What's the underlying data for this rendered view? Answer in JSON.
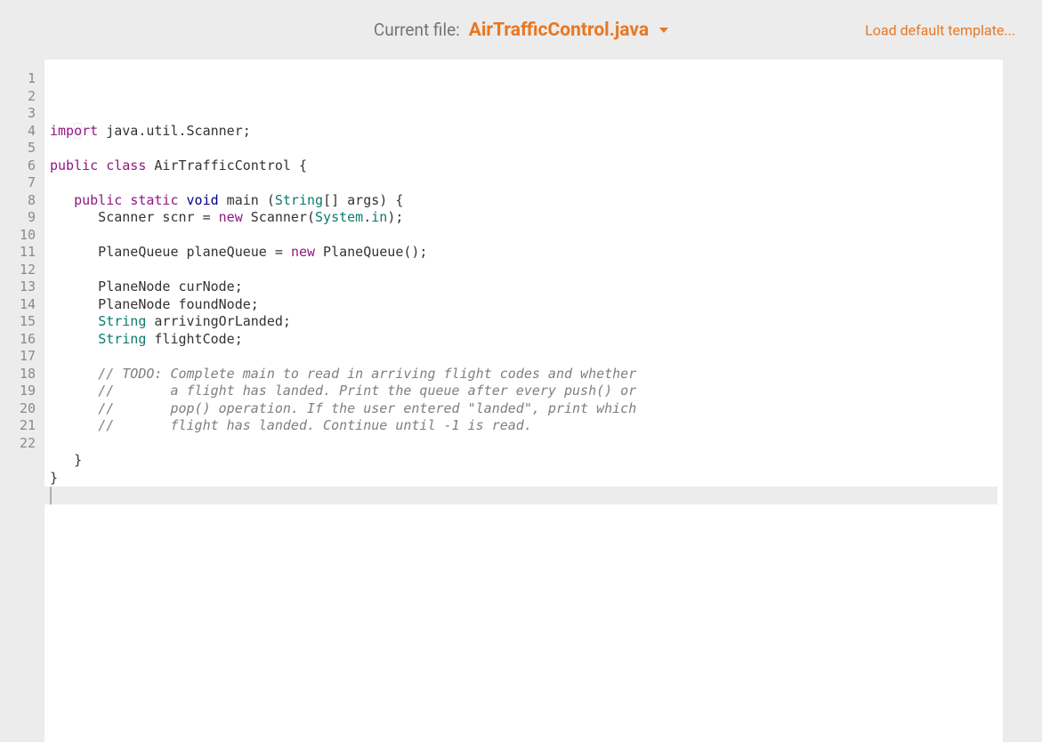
{
  "header": {
    "current_file_label": "Current file:",
    "file_name": "AirTrafficControl.java",
    "load_default": "Load default template..."
  },
  "editor": {
    "line_count": 22,
    "cursor_line": 22,
    "code_tokens": [
      [
        [
          "import",
          "kw-purple"
        ],
        [
          " java.util.Scanner;",
          ""
        ]
      ],
      [],
      [
        [
          "public",
          "kw-purple"
        ],
        [
          " ",
          ""
        ],
        [
          "class",
          "kw-purple"
        ],
        [
          " AirTrafficControl {",
          ""
        ]
      ],
      [],
      [
        [
          "   ",
          ""
        ],
        [
          "public",
          "kw-purple"
        ],
        [
          " ",
          ""
        ],
        [
          "static",
          "kw-purple"
        ],
        [
          " ",
          ""
        ],
        [
          "void",
          "kw-blue"
        ],
        [
          " main (",
          ""
        ],
        [
          "String",
          "type"
        ],
        [
          "[] args) {",
          ""
        ]
      ],
      [
        [
          "      Scanner scnr = ",
          ""
        ],
        [
          "new",
          "kw-purple"
        ],
        [
          " Scanner(",
          ""
        ],
        [
          "System",
          "type"
        ],
        [
          ".",
          ""
        ],
        [
          "in",
          "action"
        ],
        [
          ");",
          ""
        ]
      ],
      [],
      [
        [
          "      PlaneQueue planeQueue = ",
          ""
        ],
        [
          "new",
          "kw-purple"
        ],
        [
          " PlaneQueue();",
          ""
        ]
      ],
      [],
      [
        [
          "      PlaneNode curNode;",
          ""
        ]
      ],
      [
        [
          "      PlaneNode foundNode;",
          ""
        ]
      ],
      [
        [
          "      ",
          ""
        ],
        [
          "String",
          "type"
        ],
        [
          " arrivingOrLanded;",
          ""
        ]
      ],
      [
        [
          "      ",
          ""
        ],
        [
          "String",
          "type"
        ],
        [
          " flightCode;",
          ""
        ]
      ],
      [],
      [
        [
          "      ",
          ""
        ],
        [
          "// TODO: Complete main to read in arriving flight codes and whether",
          "comment"
        ]
      ],
      [
        [
          "      ",
          ""
        ],
        [
          "//       a flight has landed. Print the queue after every push() or",
          "comment"
        ]
      ],
      [
        [
          "      ",
          ""
        ],
        [
          "//       pop() operation. If the user entered \"landed\", print which",
          "comment"
        ]
      ],
      [
        [
          "      ",
          ""
        ],
        [
          "//       flight has landed. Continue until -1 is read.",
          "comment"
        ]
      ],
      [],
      [
        [
          "   }",
          ""
        ]
      ],
      [
        [
          "}",
          ""
        ]
      ],
      []
    ]
  }
}
